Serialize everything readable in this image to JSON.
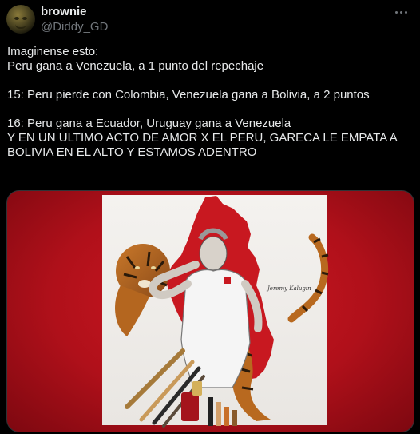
{
  "author": {
    "display_name": "brownie",
    "handle": "@Diddy_GD"
  },
  "tweet": {
    "lines": [
      "Imaginense esto:",
      "Peru gana a Venezuela, a 1 punto del repechaje",
      "",
      "15: Peru pierde con Colombia, Venezuela gana a Bolivia, a 2 puntos",
      "",
      "16: Peru gana a Ecuador, Uruguay gana a Venezuela",
      "Y EN UN ULTIMO ACTO DE AMOR X EL PERU, GARECA LE EMPATA A",
      "BOLIVIA EN EL ALTO Y ESTAMOS ADENTRO"
    ]
  },
  "media": {
    "signature": "Jeremy Kalugin"
  },
  "icons": {
    "more": "more-dots-icon"
  },
  "colors": {
    "background": "#000000",
    "text": "#e7e9ea",
    "secondary_text": "#71767b",
    "media_background": "#c0121c"
  }
}
